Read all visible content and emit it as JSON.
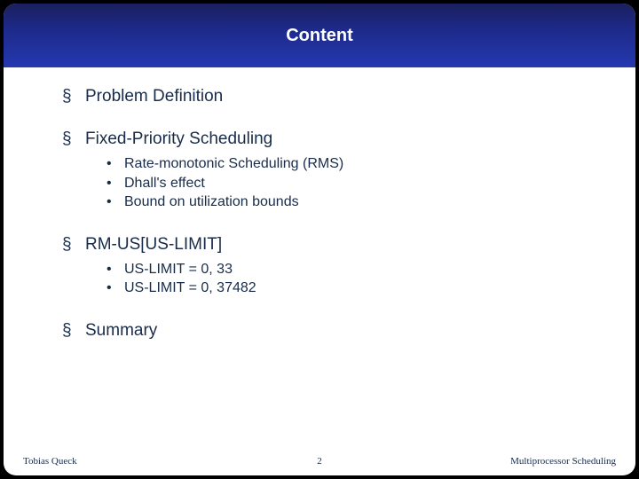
{
  "header": {
    "title": "Content"
  },
  "outline": {
    "items": [
      {
        "label": "Problem Definition"
      },
      {
        "label": "Fixed-Priority Scheduling",
        "children": [
          {
            "label": "Rate-monotonic Scheduling (RMS)"
          },
          {
            "label": "Dhall's effect"
          },
          {
            "label": "Bound on utilization bounds"
          }
        ]
      },
      {
        "label": "RM-US[US-LIMIT]",
        "children": [
          {
            "label": "US-LIMIT = 0, 33"
          },
          {
            "label": "US-LIMIT = 0, 37482"
          }
        ]
      },
      {
        "label": "Summary"
      }
    ]
  },
  "footer": {
    "author": "Tobias Queck",
    "page": "2",
    "topic": "Multiprocessor Scheduling"
  }
}
